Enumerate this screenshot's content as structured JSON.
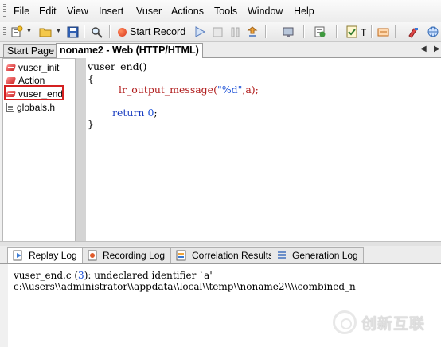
{
  "menubar": {
    "items": [
      "File",
      "Edit",
      "View",
      "Insert",
      "Vuser",
      "Actions",
      "Tools",
      "Window",
      "Help"
    ]
  },
  "toolbar": {
    "start_record_label": "Start Record",
    "t_label": "T"
  },
  "tabs": {
    "items": [
      "Start Page",
      "noname2 - Web (HTTP/HTML)"
    ],
    "active": "noname2 - Web (HTTP/HTML)"
  },
  "tree": {
    "items": [
      {
        "label": "vuser_init",
        "icon": "action-icon"
      },
      {
        "label": "Action",
        "icon": "action-icon"
      },
      {
        "label": "vuser_end",
        "icon": "action-icon",
        "highlighted": true
      },
      {
        "label": "globals.h",
        "icon": "file-icon"
      }
    ]
  },
  "editor": {
    "line1": "vuser_end()",
    "line2": "{",
    "call_name": "lr_output_message(",
    "call_fmt": "\"%d\"",
    "call_rest": ",a);",
    "return_kw": "return",
    "return_val": "0",
    "return_end": ";",
    "line_close": "}"
  },
  "log_tabs": {
    "items": [
      "Replay Log",
      "Recording Log",
      "Correlation Results",
      "Generation Log"
    ],
    "active": "Replay Log"
  },
  "log": {
    "line1_prefix": "vuser_end.c (",
    "line1_num": "3",
    "line1_suffix": "): undeclared identifier `a'",
    "line2": "c:\\\\users\\\\administrator\\\\appdata\\\\local\\\\temp\\\\noname2\\\\\\\\combined_n"
  },
  "watermark": {
    "text": "创新互联"
  },
  "colors": {
    "highlight_border": "#d42020",
    "keyword_red": "#b01c1c",
    "string_blue": "#1a4fd6",
    "record_red": "#d9381e"
  }
}
